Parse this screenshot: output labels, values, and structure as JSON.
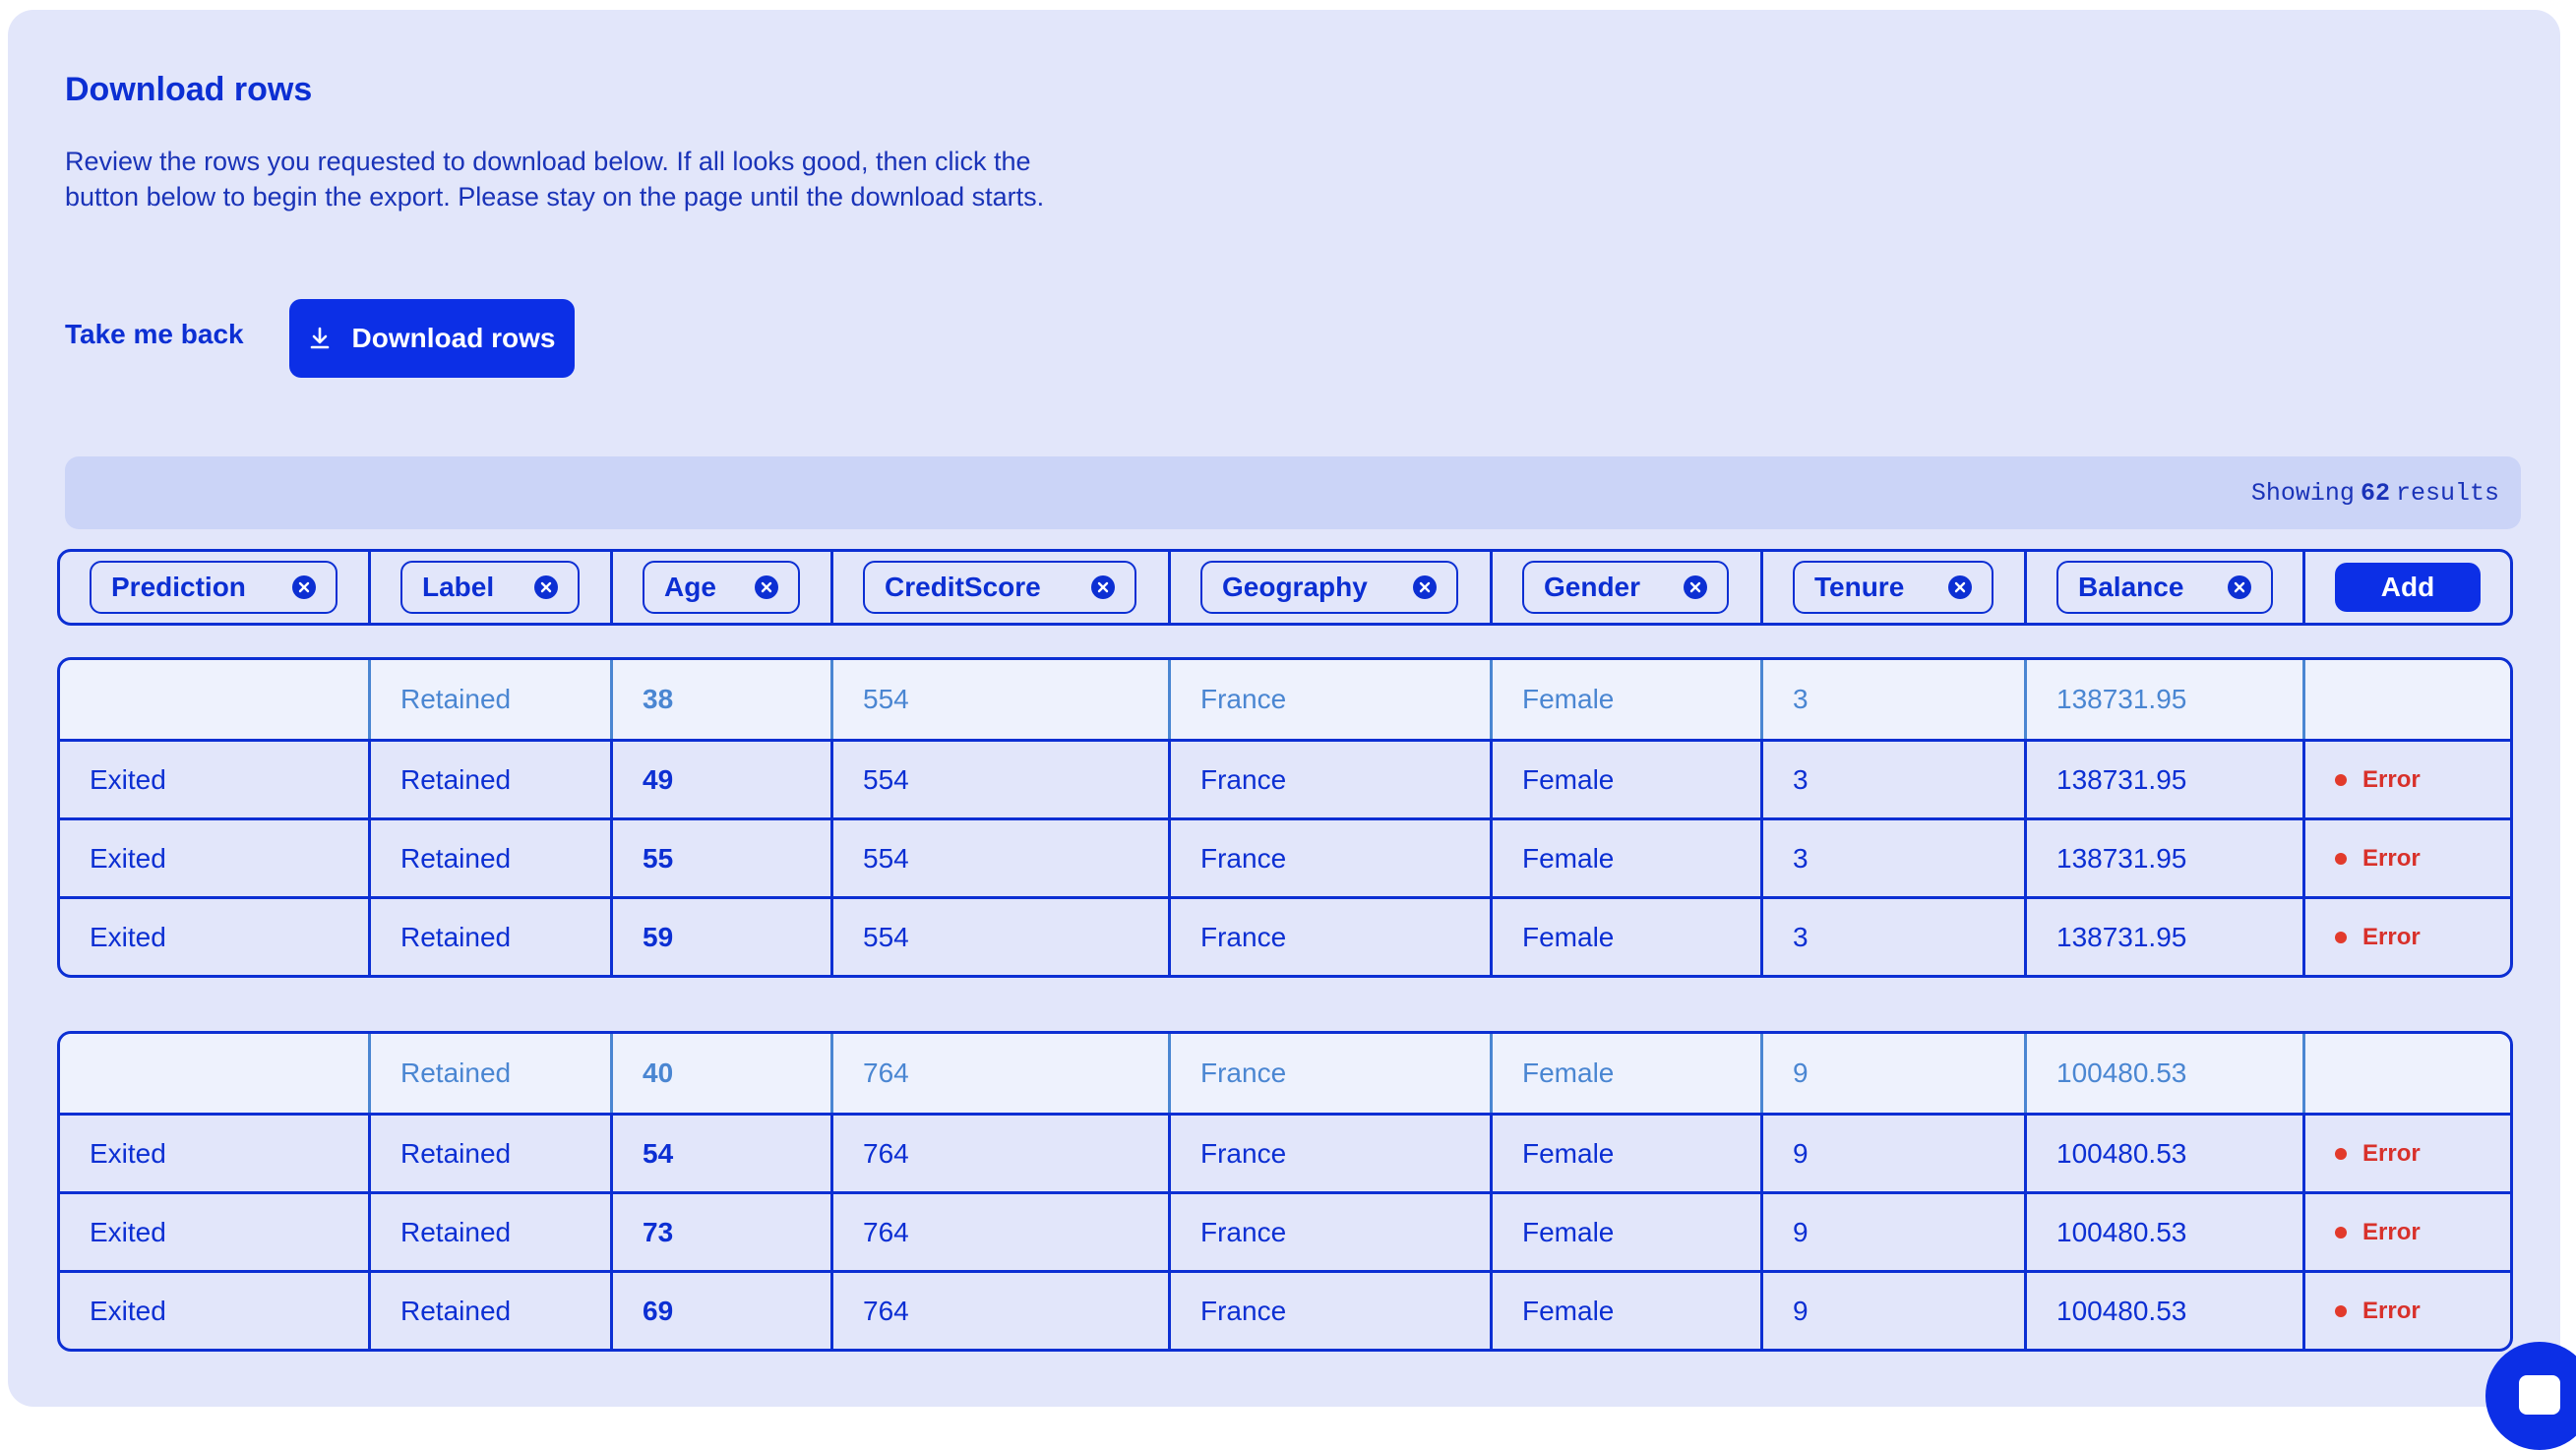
{
  "page": {
    "title": "Download rows",
    "description": "Review the rows you requested to download below. If all looks good, then click the button below to begin the export. Please stay on the page until the download starts.",
    "back_label": "Take me back",
    "download_label": "Download rows"
  },
  "results": {
    "prefix": "Showing",
    "count": "62",
    "suffix": "results"
  },
  "columns": [
    {
      "label": "Prediction"
    },
    {
      "label": "Label"
    },
    {
      "label": "Age"
    },
    {
      "label": "CreditScore"
    },
    {
      "label": "Geography"
    },
    {
      "label": "Gender"
    },
    {
      "label": "Tenure"
    },
    {
      "label": "Balance"
    }
  ],
  "add_label": "Add",
  "groups": [
    {
      "rows": [
        {
          "prediction": "",
          "label": "Retained",
          "age": "38",
          "credit": "554",
          "geo": "France",
          "gender": "Female",
          "tenure": "3",
          "balance": "138731.95",
          "status": ""
        },
        {
          "prediction": "Exited",
          "label": "Retained",
          "age": "49",
          "credit": "554",
          "geo": "France",
          "gender": "Female",
          "tenure": "3",
          "balance": "138731.95",
          "status": "Error"
        },
        {
          "prediction": "Exited",
          "label": "Retained",
          "age": "55",
          "credit": "554",
          "geo": "France",
          "gender": "Female",
          "tenure": "3",
          "balance": "138731.95",
          "status": "Error"
        },
        {
          "prediction": "Exited",
          "label": "Retained",
          "age": "59",
          "credit": "554",
          "geo": "France",
          "gender": "Female",
          "tenure": "3",
          "balance": "138731.95",
          "status": "Error"
        }
      ]
    },
    {
      "rows": [
        {
          "prediction": "",
          "label": "Retained",
          "age": "40",
          "credit": "764",
          "geo": "France",
          "gender": "Female",
          "tenure": "9",
          "balance": "100480.53",
          "status": ""
        },
        {
          "prediction": "Exited",
          "label": "Retained",
          "age": "54",
          "credit": "764",
          "geo": "France",
          "gender": "Female",
          "tenure": "9",
          "balance": "100480.53",
          "status": "Error"
        },
        {
          "prediction": "Exited",
          "label": "Retained",
          "age": "73",
          "credit": "764",
          "geo": "France",
          "gender": "Female",
          "tenure": "9",
          "balance": "100480.53",
          "status": "Error"
        },
        {
          "prediction": "Exited",
          "label": "Retained",
          "age": "69",
          "credit": "764",
          "geo": "France",
          "gender": "Female",
          "tenure": "9",
          "balance": "100480.53",
          "status": "Error"
        }
      ]
    }
  ],
  "colors": {
    "accent": "#0c2fe6",
    "panel": "#e2e6fa",
    "original_text": "#4a86d2",
    "error": "#d8312b"
  }
}
